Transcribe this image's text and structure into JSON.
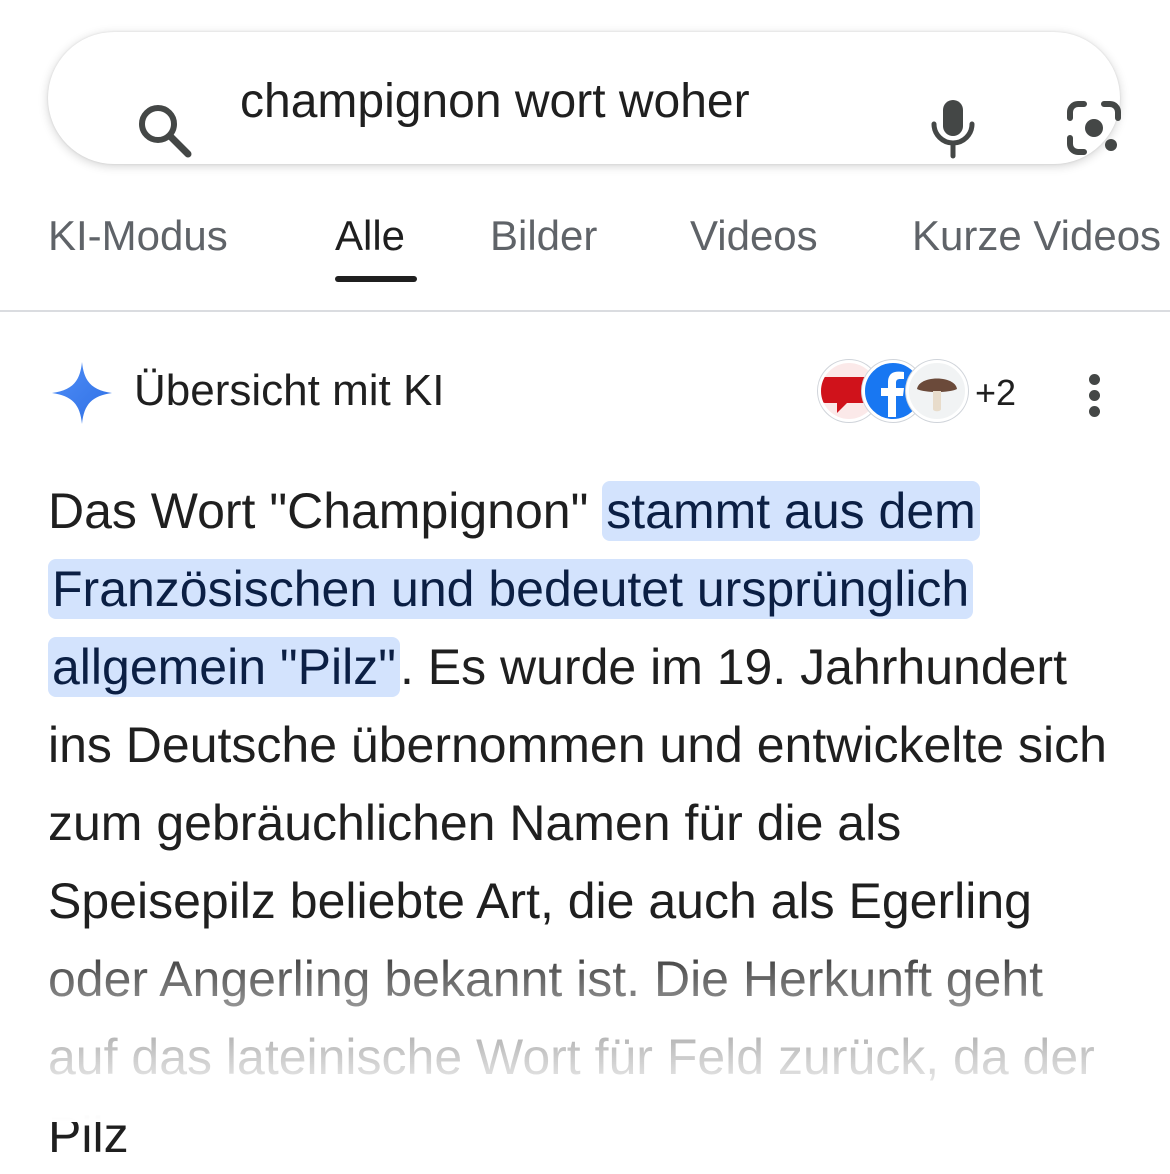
{
  "search": {
    "query": "champignon wort woher",
    "icons": [
      "search-icon",
      "microphone-icon",
      "camera-lens-icon"
    ]
  },
  "tabs": [
    {
      "label": "KI-Modus"
    },
    {
      "label": "Alle",
      "active": true
    },
    {
      "label": "Bilder"
    },
    {
      "label": "Videos"
    },
    {
      "label": "Kurze Videos"
    }
  ],
  "ai_overview": {
    "title": "Übersicht mit KI",
    "sources_more": "+2",
    "source_icons": [
      "speech-bubble-icon",
      "facebook-icon",
      "mushroom-icon"
    ],
    "text_before": "Das Wort \"Champignon\" ",
    "text_highlight": "stammt aus dem Französischen und bedeutet ursprünglich allgemein \"Pilz\"",
    "text_after": ". Es wurde im 19. Jahrhundert ins Deutsche übernommen und entwickelte sich zum gebräuchlichen Namen für die als Speisepilz beliebte Art, die auch als Egerling oder Angerling bekannt ist. Die Herkunft geht auf das lateinische Wort für Feld zurück, da der Pilz",
    "highlight_color": "#d3e3fd",
    "spark_color": "#4285f4"
  }
}
